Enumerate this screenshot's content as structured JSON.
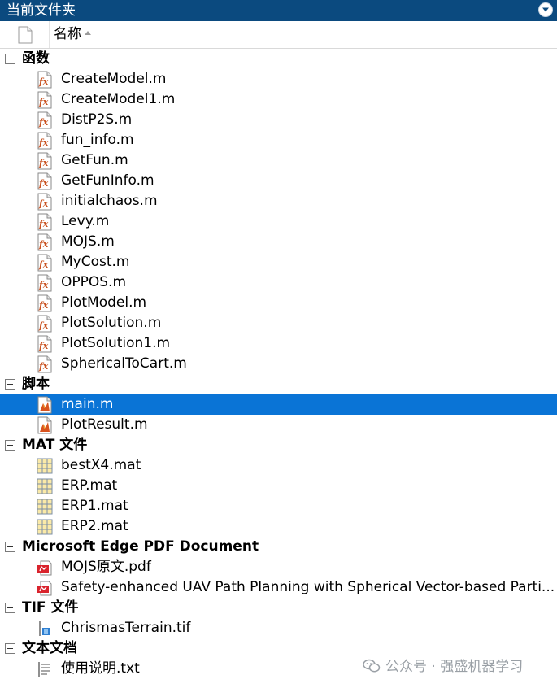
{
  "panel": {
    "title": "当前文件夹"
  },
  "header": {
    "name_col": "名称"
  },
  "groups": [
    {
      "id": "functions",
      "label": "函数",
      "files": [
        {
          "name": "CreateModel.m",
          "icon": "function-file-icon"
        },
        {
          "name": "CreateModel1.m",
          "icon": "function-file-icon"
        },
        {
          "name": "DistP2S.m",
          "icon": "function-file-icon"
        },
        {
          "name": "fun_info.m",
          "icon": "function-file-icon"
        },
        {
          "name": "GetFun.m",
          "icon": "function-file-icon"
        },
        {
          "name": "GetFunInfo.m",
          "icon": "function-file-icon"
        },
        {
          "name": "initialchaos.m",
          "icon": "function-file-icon"
        },
        {
          "name": "Levy.m",
          "icon": "function-file-icon"
        },
        {
          "name": "MOJS.m",
          "icon": "function-file-icon"
        },
        {
          "name": "MyCost.m",
          "icon": "function-file-icon"
        },
        {
          "name": "OPPOS.m",
          "icon": "function-file-icon"
        },
        {
          "name": "PlotModel.m",
          "icon": "function-file-icon"
        },
        {
          "name": "PlotSolution.m",
          "icon": "function-file-icon"
        },
        {
          "name": "PlotSolution1.m",
          "icon": "function-file-icon"
        },
        {
          "name": "SphericalToCart.m",
          "icon": "function-file-icon"
        }
      ]
    },
    {
      "id": "scripts",
      "label": "脚本",
      "files": [
        {
          "name": "main.m",
          "icon": "script-file-icon",
          "selected": true
        },
        {
          "name": "PlotResult.m",
          "icon": "script-file-icon"
        }
      ]
    },
    {
      "id": "mat",
      "label": "MAT 文件",
      "files": [
        {
          "name": "bestX4.mat",
          "icon": "mat-file-icon"
        },
        {
          "name": "ERP.mat",
          "icon": "mat-file-icon"
        },
        {
          "name": "ERP1.mat",
          "icon": "mat-file-icon"
        },
        {
          "name": "ERP2.mat",
          "icon": "mat-file-icon"
        }
      ]
    },
    {
      "id": "pdf",
      "label": "Microsoft Edge PDF Document",
      "files": [
        {
          "name": "MOJS原文.pdf",
          "icon": "pdf-file-icon"
        },
        {
          "name": "Safety-enhanced UAV Path Planning with Spherical Vector-based Parti...",
          "icon": "pdf-file-icon"
        }
      ]
    },
    {
      "id": "tif",
      "label": "TIF 文件",
      "files": [
        {
          "name": "ChrismasTerrain.tif",
          "icon": "tif-file-icon"
        }
      ]
    },
    {
      "id": "text",
      "label": "文本文档",
      "files": [
        {
          "name": "使用说明.txt",
          "icon": "text-file-icon"
        }
      ]
    }
  ],
  "watermark": {
    "text": "公众号 · 强盛机器学习"
  },
  "colors": {
    "title_bg": "#0b4a7f",
    "selection": "#0a74d6"
  }
}
